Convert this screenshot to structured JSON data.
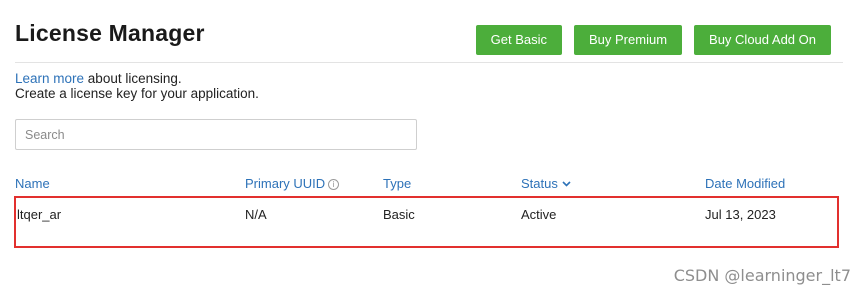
{
  "header": {
    "title": "License Manager",
    "buttons": {
      "get_basic": "Get Basic",
      "buy_premium": "Buy Premium",
      "buy_cloud_addon": "Buy Cloud Add On"
    }
  },
  "intro": {
    "link_text": "Learn more",
    "line1_rest": " about licensing.",
    "line2": "Create a license key for your application."
  },
  "search": {
    "placeholder": "Search",
    "value": ""
  },
  "table": {
    "columns": {
      "name": "Name",
      "primary_uuid": "Primary UUID",
      "type": "Type",
      "status": "Status",
      "date_modified": "Date Modified"
    },
    "rows": [
      {
        "name": "ltqer_ar",
        "primary_uuid": "N/A",
        "type": "Basic",
        "status": "Active",
        "date_modified": "Jul 13, 2023"
      }
    ]
  },
  "icons": {
    "info": "info-icon",
    "sort_status": "chevron-down-icon"
  },
  "colors": {
    "primary_button": "#4cae3b",
    "link": "#2d72b8",
    "highlight_border": "#e2302e"
  },
  "watermark": "CSDN @learninger_lt7"
}
